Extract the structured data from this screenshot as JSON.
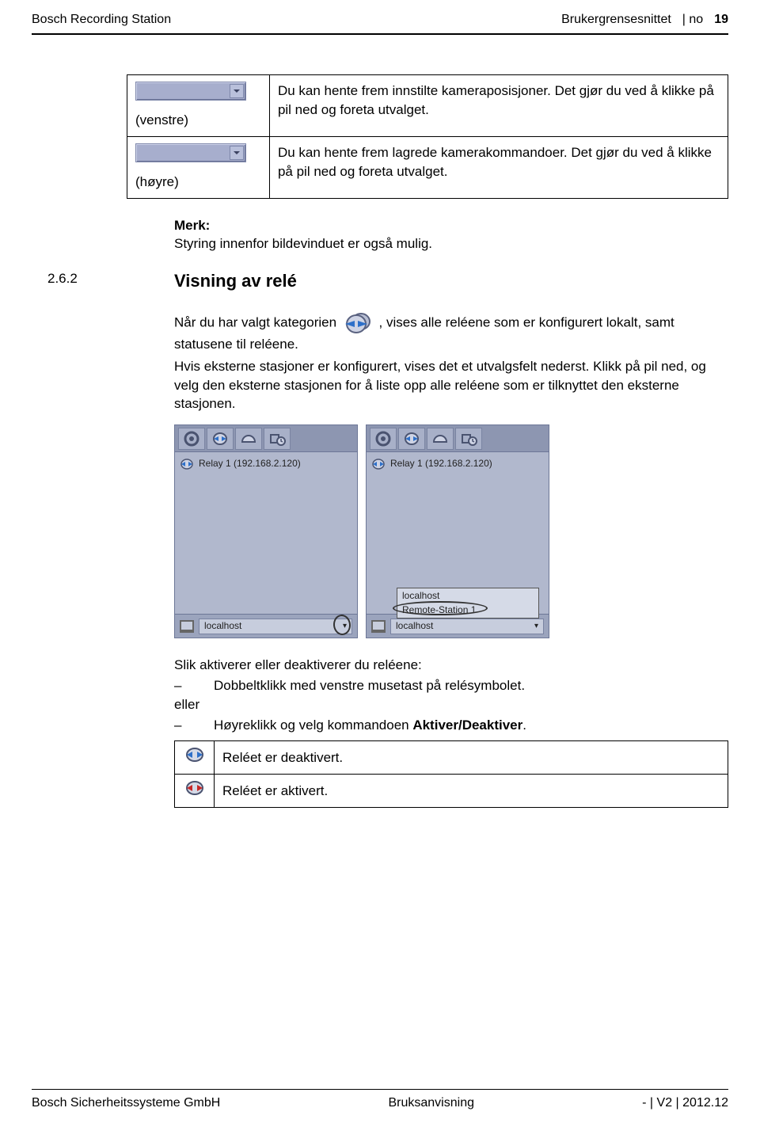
{
  "header": {
    "left": "Bosch Recording Station",
    "section": "Brukergrensesnittet",
    "divider": "| no",
    "page": "19"
  },
  "dropdown_table": {
    "row1_label": "(venstre)",
    "row1_text": "Du kan hente frem innstilte kameraposisjoner. Det gjør du ved å klikke på pil ned og foreta utvalget.",
    "row2_label": "(høyre)",
    "row2_text": "Du kan hente frem lagrede kamerakommandoer. Det gjør du ved å klikke på pil ned og foreta utvalget."
  },
  "note_label": "Merk:",
  "note_text": "Styring innenfor bildevinduet er også mulig.",
  "section_number": "2.6.2",
  "section_title": "Visning av relé",
  "para1_a": "Når du har valgt kategorien ",
  "para1_b": ", vises alle reléene som er konfigurert lokalt, samt statusene til reléene.",
  "para2": "Hvis eksterne stasjoner er konfigurert, vises det et utvalgsfelt nederst. Klikk på pil ned, og velg den eksterne stasjonen for å liste opp alle reléene som er tilknyttet den eksterne stasjonen.",
  "panel": {
    "relay_label": "Relay 1 (192.168.2.120)",
    "localhost": "localhost",
    "remote": "Remote-Station 1"
  },
  "activate_intro": "Slik aktiverer eller deaktiverer du reléene:",
  "activate_b1": "Dobbeltklikk med venstre musetast på relésymbolet.",
  "or_word": "eller",
  "activate_b2a": "Høyreklikk og velg kommandoen ",
  "activate_b2b": "Aktiver/Deaktiver",
  "activate_b2c": ".",
  "status_table": {
    "deact": "Reléet er deaktivert.",
    "act": "Reléet er aktivert."
  },
  "footer": {
    "left": "Bosch Sicherheitssysteme GmbH",
    "center": "Bruksanvisning",
    "right": "- | V2 | 2012.12"
  }
}
